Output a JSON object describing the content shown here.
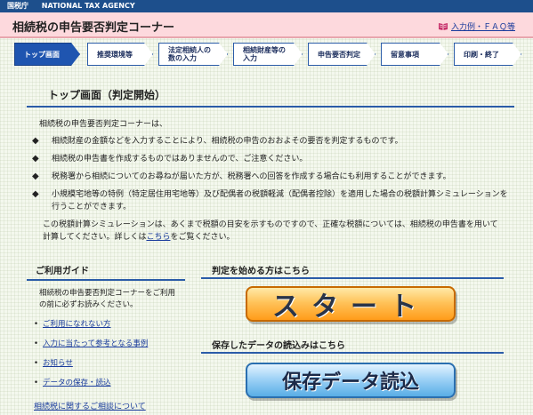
{
  "agency": {
    "name_ja": "国税庁",
    "name_en": "NATIONAL TAX AGENCY"
  },
  "header": {
    "title": "相続税の申告要否判定コーナー",
    "faq_link": "入力例・ＦＡＱ等"
  },
  "steps": [
    {
      "label": "トップ画面",
      "active": true
    },
    {
      "label": "推奨環境等",
      "active": false
    },
    {
      "label": "法定相続人の数の入力",
      "active": false
    },
    {
      "label": "相続財産等の入力",
      "active": false
    },
    {
      "label": "申告要否判定",
      "active": false
    },
    {
      "label": "留意事項",
      "active": false
    },
    {
      "label": "印刷・終了",
      "active": false
    }
  ],
  "main": {
    "heading": "トップ画面（判定開始）",
    "intro": "相続税の申告要否判定コーナーは、",
    "bullets": [
      "相続財産の金額などを入力することにより、相続税の申告のおおよその要否を判定するものです。",
      "相続税の申告書を作成するものではありませんので、ご注意ください。",
      "税務署から相続についてのお尋ねが届いた方が、税務署への回答を作成する場合にも利用することができます。",
      "小規模宅地等の特例（特定居住用宅地等）及び配偶者の税額軽減（配偶者控除）を適用した場合の税額計算シミュレーションを行うことができます。"
    ],
    "note_before_link": "この税額計算シミュレーションは、あくまで税額の目安を示すものですので、正確な税額については、相続税の申告書を用いて計算してください。詳しくは",
    "note_link": "こちら",
    "note_after_link": "をご覧ください。"
  },
  "guide": {
    "title": "ご利用ガイド",
    "text": "相続税の申告要否判定コーナーをご利用の前に必ずお読みください。",
    "links": [
      "ご利用になれない方",
      "入力に当たって参考となる事例",
      "お知らせ",
      "データの保存・読込"
    ],
    "consult_link": "相続税に関するご相談について"
  },
  "start_panel": {
    "start_title": "判定を始める方はこちら",
    "start_button": "スタート",
    "load_title": "保存したデータの読込みはこちら",
    "load_button": "保存データ読込"
  },
  "colors": {
    "header_blue": "#1d4f8c",
    "title_pink": "#fdd9dd",
    "accent_blue": "#2b5ca8",
    "start_orange": "#ff9c1a",
    "load_blue": "#59aee6"
  }
}
